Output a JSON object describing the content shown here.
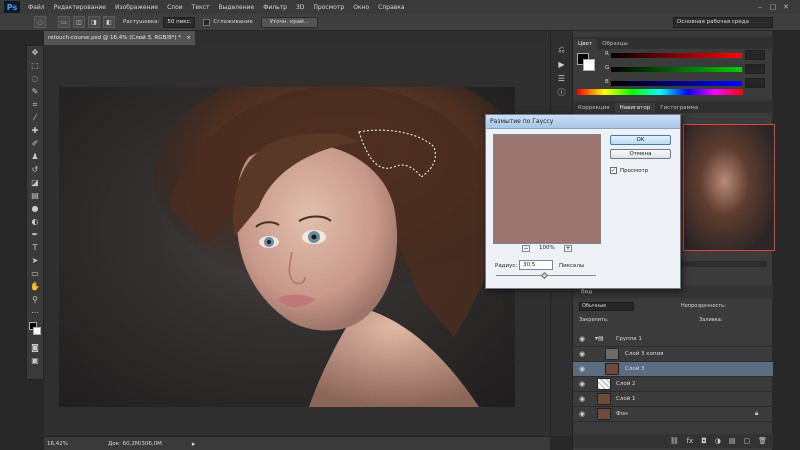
{
  "app": {
    "logo": "Ps"
  },
  "menu": [
    "Файл",
    "Редактирование",
    "Изображение",
    "Слои",
    "Текст",
    "Выделение",
    "Фильтр",
    "3D",
    "Просмотр",
    "Окно",
    "Справка"
  ],
  "options": {
    "feather_label": "Растушевка:",
    "feather_value": "50 пикс.",
    "smoothing_label": "Сглаживание",
    "refine_edge_button": "Уточн. край...",
    "workspace": "Основная рабочая среда"
  },
  "document": {
    "tab_title": "retouch-course.psd @ 16,4% (Слой 3, RGB/8*) *",
    "zoom": "16,42%",
    "doc_info": "Док: 60,2M/306,0M"
  },
  "color_panel": {
    "tabs": [
      "Цвет",
      "Образцы"
    ],
    "sliders": [
      {
        "label": "R",
        "value": "",
        "color": "#ff0000"
      },
      {
        "label": "G",
        "value": "",
        "color": "#00cc00"
      },
      {
        "label": "B",
        "value": "",
        "color": "#0000ff"
      }
    ]
  },
  "navigator_panel": {
    "tabs": [
      "Коррекция",
      "Навигатор",
      "Гистограмма"
    ]
  },
  "layers_panel": {
    "filter_label": "Вид",
    "blend_mode": "Обычные",
    "opacity_label": "Непрозрачность:",
    "lock_label": "Закрепить:",
    "fill_label": "Заливка:",
    "layers": [
      {
        "name": "Группа 1",
        "type": "group"
      },
      {
        "name": "Слой 3 копия",
        "type": "layer"
      },
      {
        "name": "Слой 3",
        "type": "layer",
        "selected": true
      },
      {
        "name": "Слой 2",
        "type": "layer"
      },
      {
        "name": "Слой 1",
        "type": "layer"
      },
      {
        "name": "Фон",
        "type": "background"
      }
    ]
  },
  "gaussian_dialog": {
    "title": "Размытие по Гауссу",
    "ok_label": "OK",
    "cancel_label": "Отмена",
    "preview_label": "Просмотр",
    "preview_checked": true,
    "preview_zoom": "100%",
    "radius_label": "Радиус:",
    "radius_value": "30,5",
    "radius_unit": "Пикселы",
    "preview_color": "#9c7470"
  }
}
